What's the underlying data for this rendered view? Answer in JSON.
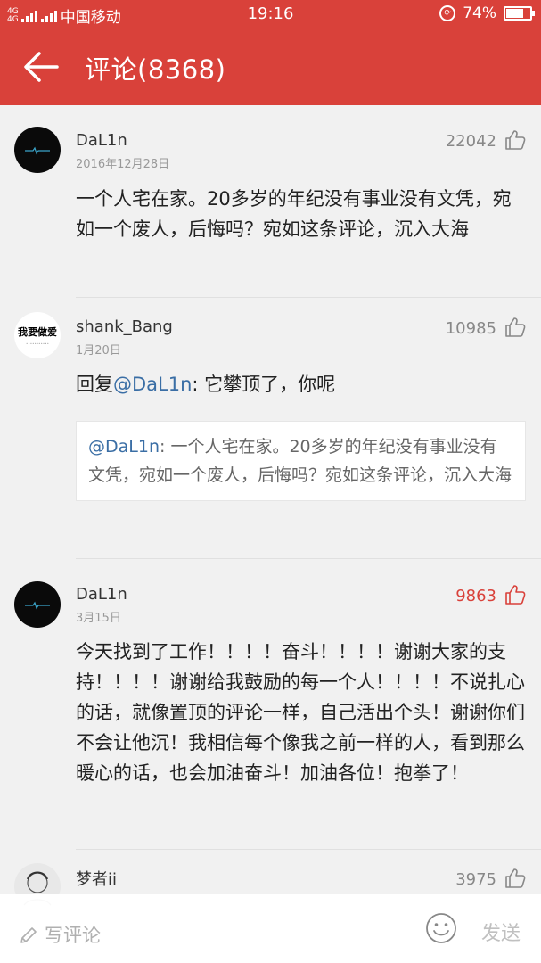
{
  "status_bar": {
    "network_top": "4G",
    "network_bottom": "4G",
    "carrier": "中国移动",
    "time": "19:16",
    "battery": "74%",
    "battery_level": 0.74
  },
  "header": {
    "back_icon": "arrow-left-icon",
    "title": "评论(8368)"
  },
  "comments": [
    {
      "username": "DaL1n",
      "date": "2016年12月28日",
      "likes": "22042",
      "liked": false,
      "text": "一个人宅在家。20多岁的年纪没有事业没有文凭，宛如一个废人，后悔吗？宛如这条评论，沉入大海"
    },
    {
      "username": "shank_Bang",
      "avatar_text": "我要做爱",
      "date": "1月20日",
      "likes": "10985",
      "liked": false,
      "reply_prefix": "回复",
      "reply_mention": "@DaL1n",
      "reply_text": ": 它攀顶了，你呢",
      "quote_mention": "@DaL1n",
      "quote_text": ": 一个人宅在家。20多岁的年纪没有事业没有文凭，宛如一个废人，后悔吗？宛如这条评论，沉入大海"
    },
    {
      "username": "DaL1n",
      "date": "3月15日",
      "likes": "9863",
      "liked": true,
      "text": "今天找到了工作！！！！奋斗！！！！谢谢大家的支持！！！！谢谢给我鼓励的每一个人！！！！不说扎心的话，就像置顶的评论一样，自己活出个头！谢谢你们不会让他沉！我相信每个像我之前一样的人，看到那么暖心的话，也会加油奋斗！加油各位！抱拳了！"
    },
    {
      "username": "梦者ii",
      "likes": "3975",
      "liked": false
    }
  ],
  "bottom_bar": {
    "write_placeholder": "写评论",
    "send_label": "发送",
    "emoji_icon": "emoji-icon"
  },
  "colors": {
    "header_red": "#d9413a",
    "liked_red": "#d9413a",
    "mention_blue": "#3a6ea5"
  }
}
